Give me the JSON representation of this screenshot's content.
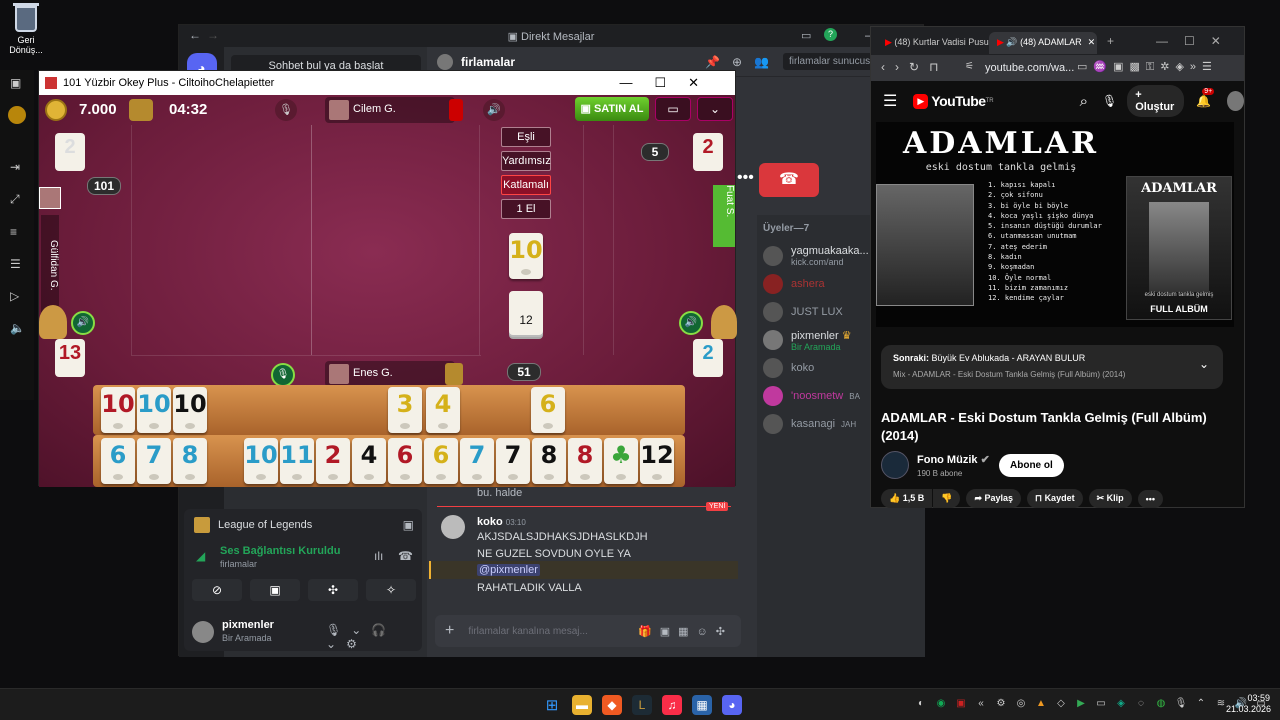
{
  "desktop": {
    "recycle_bin_label": "Geri Dönüş..."
  },
  "discord": {
    "window_title": "Direkt Mesajlar",
    "search_placeholder": "Sohbet bul ya da başlat",
    "channel_name": "firlamalar",
    "server_search": "firlamalar sunucusunu ara",
    "members_header": "Üyeler—7",
    "members": [
      {
        "name": "yagmuakaaka...",
        "status": "kick.com/and"
      },
      {
        "name": "ashera",
        "status": ""
      },
      {
        "name": "JUST LUX",
        "status": ""
      },
      {
        "name": "pixmenler",
        "status": "Bir Aramada"
      },
      {
        "name": "koko",
        "status": ""
      },
      {
        "name": "'noosmetw",
        "status": "BA"
      },
      {
        "name": "kasanagi",
        "status": "JAH"
      }
    ],
    "server_activity": "League of Legends",
    "voice_status": "Ses Bağlantısı Kuruldu",
    "voice_channel": "firlamalar",
    "user_name": "pixmenler",
    "user_status": "Bir Aramada",
    "message_prev": "bu. halde",
    "new_badge": "YENİ",
    "message_author": "koko",
    "message_time": "03:10",
    "messages": [
      "AKJSDALSJDHAKSJDHASLKDJH",
      "NE GUZEL SOVDUN OYLE YA",
      "@pixmenler",
      "RAHATLADIK VALLA"
    ],
    "chat_placeholder": "firlamalar kanalına mesaj..."
  },
  "youtube": {
    "tabs": [
      {
        "label": "(48) Kurtlar Vadisi Pusu"
      },
      {
        "label": "(48) ADAMLAR"
      }
    ],
    "url": "youtube.com/wa...",
    "logo": "YouTube",
    "logo_sup": "TR",
    "create_label": "Oluştur",
    "notif_count": "9+",
    "album": {
      "title": "ADAMLAR",
      "subtitle": "eski dostum tankla gelmiş",
      "tracklist": [
        "1. kapısı kapalı",
        "2. çok sifonu",
        "3. bi öyle bi böyle",
        "4. koca yaşlı şişko dünya",
        "5. insanın düştüğü durumlar",
        "6. utanmassan unutmam",
        "7. ateş ederim",
        "8. kadın",
        "9. koşmadan",
        "10. Öyle normal",
        "11. bizim zamanımız",
        "12. kendime çaylar"
      ],
      "cover_title": "ADAMLAR",
      "cover_sub": "eski dostum tankla gelmiş",
      "full_album": "FULL ALBÜM"
    },
    "next_label": "Sonraki:",
    "next_title": "Büyük Ev Ablukada - ARAYAN BULUR",
    "next_mix": "Mix - ADAMLAR - Eski Dostum Tankla Gelmiş (Full Albüm) (2014)",
    "video_title": "ADAMLAR - Eski Dostum Tankla Gelmiş (Full Albüm) (2014)",
    "channel": "Fono Müzik",
    "subscribers": "190 B abone",
    "subscribe": "Abone ol",
    "likes": "1,5 B",
    "share": "Paylaş",
    "save": "Kaydet",
    "clip": "Klip"
  },
  "okey": {
    "window_title": "101 Yüzbir Okey Plus - CiltoihoChelapietter",
    "coins": "7.000",
    "timer": "04:32",
    "buy_label": "SATIN AL",
    "players": {
      "top": "Cilem G.",
      "bottom": "Enes G.",
      "left": "Gülfidan G.",
      "right": "Fuat S."
    },
    "modes": [
      "Eşli",
      "Yardımsız",
      "Katlamalı",
      "1 El"
    ],
    "left_score": "101",
    "right_count": "5",
    "bottom_count": "51",
    "counters": {
      "top_left": "2",
      "top_right": "2",
      "bottom_left": "13",
      "bottom_right": "2"
    },
    "indicator_tile": "10",
    "deck_count": "12",
    "rack_top": [
      {
        "n": "10",
        "c": "red"
      },
      {
        "n": "10",
        "c": "blue"
      },
      {
        "n": "10",
        "c": "black"
      },
      {
        "n": "3",
        "c": "yellow"
      },
      {
        "n": "4",
        "c": "yellow"
      },
      {
        "n": "6",
        "c": "yellow"
      }
    ],
    "rack_bottom": [
      {
        "n": "6",
        "c": "blue"
      },
      {
        "n": "7",
        "c": "blue"
      },
      {
        "n": "8",
        "c": "blue"
      },
      {
        "n": "10",
        "c": "blue"
      },
      {
        "n": "11",
        "c": "blue"
      },
      {
        "n": "2",
        "c": "red"
      },
      {
        "n": "4",
        "c": "black"
      },
      {
        "n": "6",
        "c": "red"
      },
      {
        "n": "6",
        "c": "yellow"
      },
      {
        "n": "7",
        "c": "blue"
      },
      {
        "n": "7",
        "c": "black"
      },
      {
        "n": "8",
        "c": "black"
      },
      {
        "n": "8",
        "c": "red"
      },
      {
        "n": "♣",
        "c": "green"
      },
      {
        "n": "12",
        "c": "black"
      }
    ]
  },
  "taskbar": {
    "time": "03:59",
    "date": "21.03.2026"
  }
}
